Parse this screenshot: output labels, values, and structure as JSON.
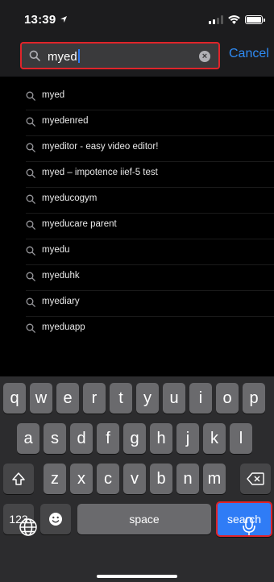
{
  "status_bar": {
    "time": "13:39"
  },
  "search": {
    "query": "myed",
    "cancel_label": "Cancel"
  },
  "suggestions": [
    "myed",
    "myedenred",
    "myeditor - easy video editor!",
    "myed – impotence iief-5 test",
    "myeducogym",
    "myeducare parent",
    "myedu",
    "myeduhk",
    "myediary",
    "myeduapp"
  ],
  "keyboard": {
    "row1": [
      "q",
      "w",
      "e",
      "r",
      "t",
      "y",
      "u",
      "i",
      "o",
      "p"
    ],
    "row2": [
      "a",
      "s",
      "d",
      "f",
      "g",
      "h",
      "j",
      "k",
      "l"
    ],
    "row3": [
      "z",
      "x",
      "c",
      "v",
      "b",
      "n",
      "m"
    ],
    "numbers_label": "123",
    "space_label": "space",
    "search_label": "search"
  },
  "colors": {
    "accent": "#2f7cf6",
    "highlight": "#e0242a",
    "background": "#000000"
  },
  "icons": [
    "location-arrow-icon",
    "signal-icon",
    "wifi-icon",
    "battery-icon",
    "search-icon",
    "clear-icon",
    "shift-icon",
    "delete-icon",
    "emoji-icon",
    "globe-icon",
    "microphone-icon"
  ]
}
